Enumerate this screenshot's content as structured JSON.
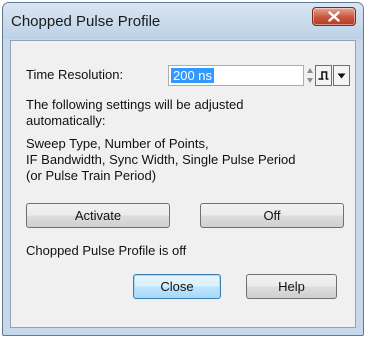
{
  "window": {
    "title": "Chopped Pulse Profile"
  },
  "time_resolution": {
    "label": "Time Resolution:",
    "value": "200 ns"
  },
  "info": {
    "line1": "The following settings will be adjusted",
    "line2": "automatically:",
    "line3": "Sweep Type, Number of Points,",
    "line4": "IF Bandwidth, Sync Width, Single Pulse Period",
    "line5": "(or Pulse Train Period)"
  },
  "buttons": {
    "activate": "Activate",
    "off": "Off",
    "close": "Close",
    "help": "Help"
  },
  "status": "Chopped Pulse Profile is off"
}
